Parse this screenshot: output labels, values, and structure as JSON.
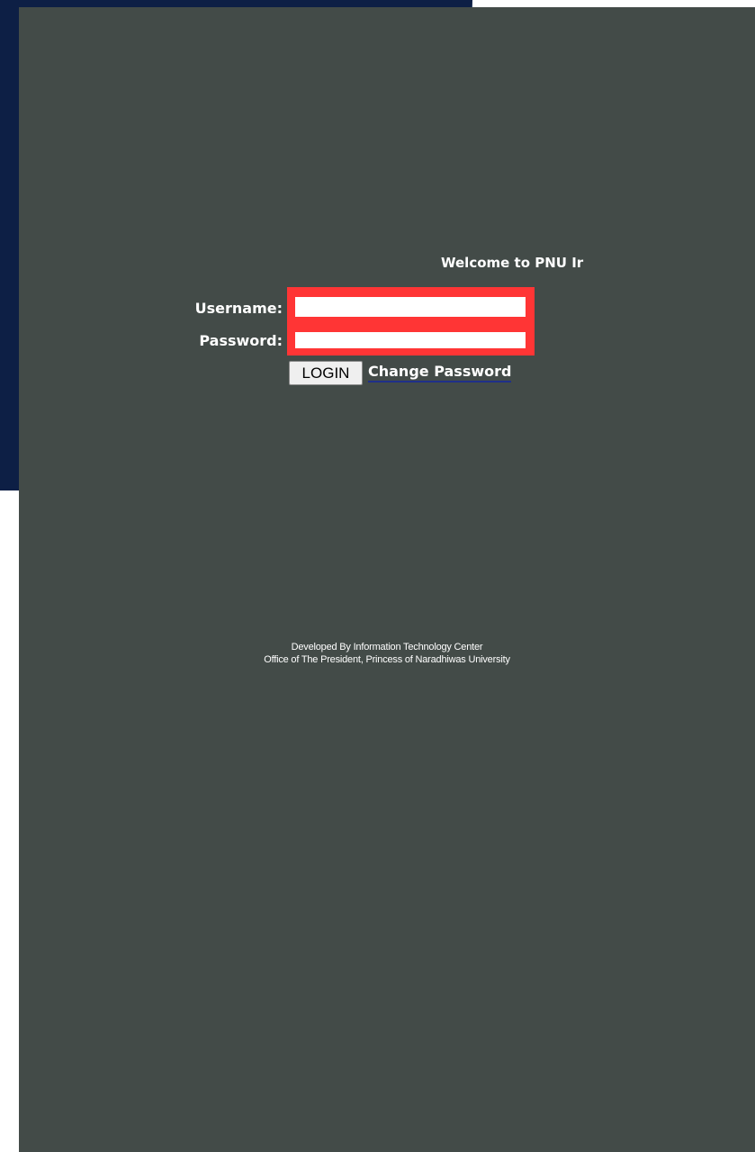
{
  "welcome_text": "Welcome to PNU Ir",
  "login_form": {
    "username_label": "Username:",
    "username_value": "",
    "password_label": "Password:",
    "password_value": "",
    "login_button_label": "LOGIN",
    "change_password_link": "Change Password"
  },
  "footer": {
    "line1": "Developed By Information Technology Center",
    "line2": "Office of The President, Princess of Naradhiwas University"
  },
  "colors": {
    "panel_background": "#434b48",
    "navy_backdrop": "#0d1f45",
    "highlight_border": "#ff3535",
    "text": "#ffffff"
  }
}
